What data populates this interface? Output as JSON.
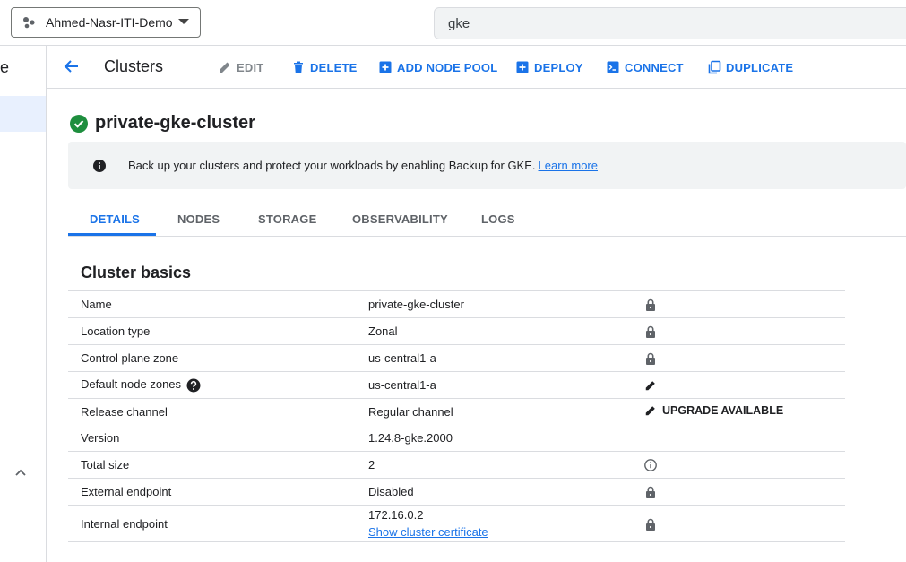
{
  "topbar": {
    "project_name": "Ahmed-Nasr-ITI-Demo",
    "search_value": "gke",
    "project_icon": "project-dots-icon"
  },
  "leftnav": {
    "partial_label": "e"
  },
  "actionbar": {
    "title": "Clusters",
    "actions": [
      {
        "label": "EDIT",
        "icon": "pencil-icon"
      },
      {
        "label": "DELETE",
        "icon": "trash-icon"
      },
      {
        "label": "ADD NODE POOL",
        "icon": "add-box-icon"
      },
      {
        "label": "DEPLOY",
        "icon": "add-box-icon"
      },
      {
        "label": "CONNECT",
        "icon": "terminal-icon"
      },
      {
        "label": "DUPLICATE",
        "icon": "copy-icon"
      }
    ]
  },
  "cluster": {
    "name": "private-gke-cluster",
    "status_icon": "check-circle-icon"
  },
  "banner": {
    "text": "Back up your clusters and protect your workloads by enabling Backup for GKE.",
    "link": "Learn more"
  },
  "tabs": [
    "DETAILS",
    "NODES",
    "STORAGE",
    "OBSERVABILITY",
    "LOGS"
  ],
  "section": {
    "title": "Cluster basics"
  },
  "rows": [
    {
      "label": "Name",
      "value": "private-gke-cluster",
      "icon": "lock-icon"
    },
    {
      "label": "Location type",
      "value": "Zonal",
      "icon": "lock-icon"
    },
    {
      "label": "Control plane zone",
      "value": "us-central1-a",
      "icon": "lock-icon"
    },
    {
      "label": "Default node zones",
      "value": "us-central1-a",
      "icon": "pencil-icon"
    },
    {
      "label": "Release channel",
      "value": "Regular channel",
      "icon": "pencil-icon",
      "action": "UPGRADE AVAILABLE"
    },
    {
      "label": "Version",
      "value": "1.24.8-gke.2000"
    },
    {
      "label": "Total size",
      "value": "2",
      "icon": "info-icon"
    },
    {
      "label": "External endpoint",
      "value": "Disabled",
      "icon": "lock-icon"
    },
    {
      "label": "Internal endpoint",
      "value": "172.16.0.2",
      "link": "Show cluster certificate",
      "icon": "lock-icon"
    }
  ],
  "colors": {
    "accent": "#1a73e8",
    "success": "#1e8e3e",
    "border": "#dadce0"
  }
}
